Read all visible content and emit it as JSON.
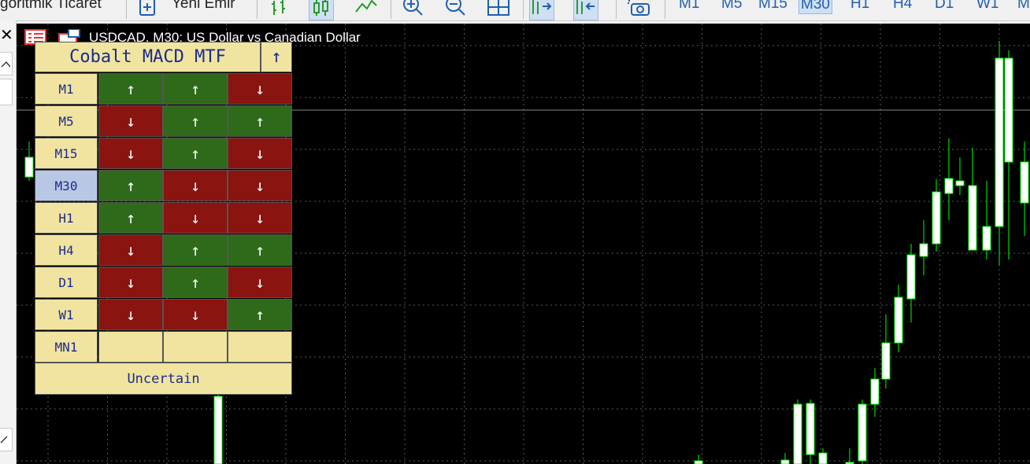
{
  "toolbar": {
    "algo_label": "goritmik Ticaret",
    "new_order_label": "Yeni Emir",
    "timeframes": [
      "M1",
      "M5",
      "M15",
      "M30",
      "H1",
      "H4",
      "D1",
      "W1",
      "M"
    ],
    "active_timeframe": "M30"
  },
  "chart": {
    "title": "USDCAD, M30:  US Dollar vs Canadian Dollar",
    "background": "#000000",
    "up_candle_color": "#00ff00",
    "down_candle_color": "#ffffff"
  },
  "panel": {
    "title": "Cobalt MACD MTF",
    "title_arrow": "↑",
    "selected_timeframe": "M30",
    "rows": [
      {
        "tf": "M1",
        "s": [
          "↑",
          "↑",
          "↓"
        ]
      },
      {
        "tf": "M5",
        "s": [
          "↓",
          "↑",
          "↑"
        ]
      },
      {
        "tf": "M15",
        "s": [
          "↓",
          "↑",
          "↓"
        ]
      },
      {
        "tf": "M30",
        "s": [
          "↑",
          "↓",
          "↓"
        ]
      },
      {
        "tf": "H1",
        "s": [
          "↑",
          "↓",
          "↓"
        ]
      },
      {
        "tf": "H4",
        "s": [
          "↓",
          "↑",
          "↑"
        ]
      },
      {
        "tf": "D1",
        "s": [
          "↓",
          "↑",
          "↓"
        ]
      },
      {
        "tf": "W1",
        "s": [
          "↓",
          "↓",
          "↑"
        ]
      },
      {
        "tf": "MN1",
        "s": [
          "",
          "",
          ""
        ]
      }
    ],
    "status": "Uncertain",
    "colors": {
      "up": "#2e6a1a",
      "down": "#8a1410",
      "label_bg": "#f0e4a0",
      "label_text": "#1a2b8c",
      "selected_bg": "#b8c8e4"
    }
  }
}
